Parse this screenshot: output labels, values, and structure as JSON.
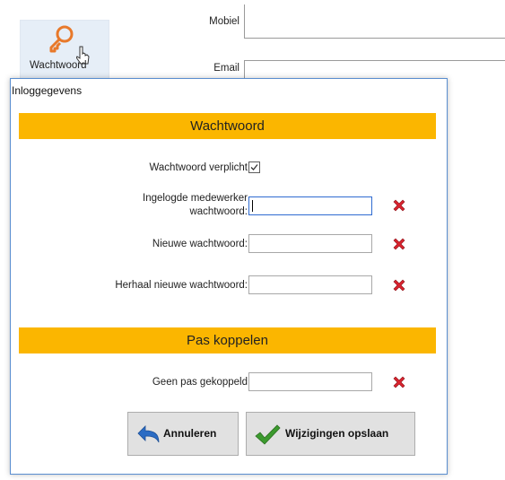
{
  "background": {
    "toolbar_button_label": "Wachtwoord",
    "fields": [
      {
        "label": "Mobiel"
      },
      {
        "label": "Email"
      }
    ]
  },
  "dialog": {
    "title": "Inloggegevens",
    "password_section": {
      "header": "Wachtwoord",
      "required_label": "Wachtwoord verplicht",
      "required_checked": true,
      "employee_password_label_line1": "Ingelogde medewerker",
      "employee_password_label_line2": "wachtwoord:",
      "employee_password_value": "",
      "new_password_label": "Nieuwe wachtwoord:",
      "new_password_value": "",
      "repeat_password_label": "Herhaal nieuwe wachtwoord:",
      "repeat_password_value": ""
    },
    "pass_section": {
      "header": "Pas koppelen",
      "no_pass_label": "Geen pas gekoppeld",
      "pass_value": ""
    },
    "buttons": {
      "cancel_label": "Annuleren",
      "save_label": "Wijzigingen opslaan"
    },
    "colors": {
      "section_header": "#fbb600",
      "clear_icon": "#d9232e",
      "save_check": "#3c9a2e",
      "cancel_arrow": "#2b6cc4"
    },
    "icons": [
      "key-icon",
      "cursor-icon",
      "checkmark-icon",
      "clear-icon",
      "undo-icon",
      "save-check-icon"
    ]
  }
}
